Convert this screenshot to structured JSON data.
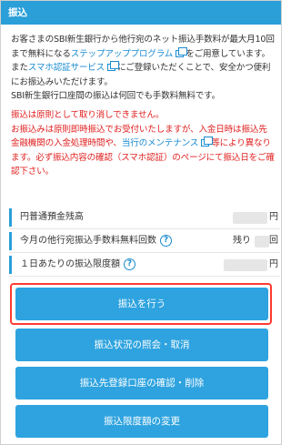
{
  "header": {
    "title": "振込"
  },
  "notice": {
    "line1": "お客さまのSBI新生銀行から他行宛のネット振込手数料が最大月10回まで無料になる",
    "stepup_link": "ステップアッププログラム",
    "line1_end": "をご用意しています。",
    "line2_start": "また",
    "sumaho_link": "スマホ認証サービス",
    "line2_end": "にご登録いただくことで、安全かつ便利にお振込みいただけます。",
    "line3": "SBI新生銀行口座間の振込は何回でも手数料無料です。",
    "red1": "振込は原則として取り消しできません。",
    "red2_start": "お振込みは原則即時振込でお受付いたしますが、入金日時は振込先金融機関の入金処理時間や、",
    "maint_link": "当行のメンテナンス",
    "red2_end": "等により異なります。必ず振込内容の確認（スマホ認証）のページにて振込日をご確認下さい。"
  },
  "table": {
    "rows": [
      {
        "label": "円普通預金残高",
        "unit": "円",
        "value": ""
      },
      {
        "label": "今月の他行宛振込手数料無料回数",
        "unit": "回",
        "prefix": "残り",
        "value": ""
      },
      {
        "label": "１日あたりの振込限度額",
        "unit": "円",
        "value": ""
      }
    ]
  },
  "buttons": {
    "transfer": "振込を行う",
    "status": "振込状況の照会・取消",
    "registered": "振込先登録口座の確認・削除",
    "limit": "振込限度額の変更"
  },
  "colors": {
    "header": "#2a9fd8",
    "button": "#2ea3df",
    "red": "#e02020",
    "link": "#1a8bd0",
    "highlight": "#ff3b30"
  }
}
